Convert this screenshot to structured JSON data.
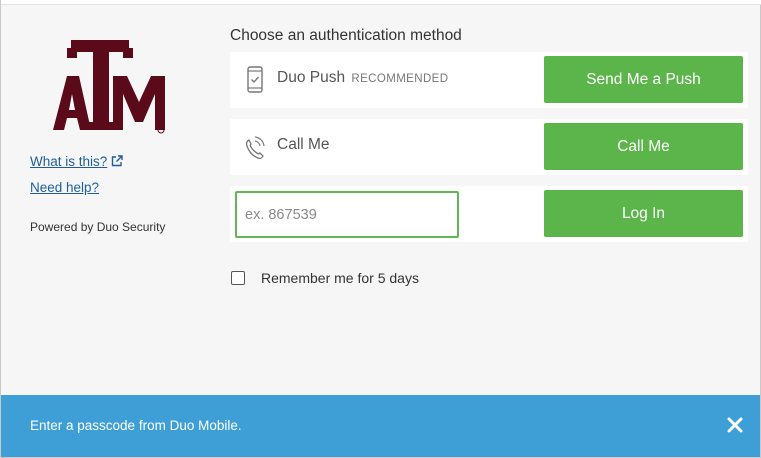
{
  "left_panel": {
    "logo_icon": "texas-am-logo",
    "logo_color": "#5b0a1a",
    "what_is_this": "What is this?",
    "need_help": "Need help?",
    "powered_by": "Powered by Duo Security"
  },
  "auth": {
    "heading": "Choose an authentication method",
    "methods": [
      {
        "icon": "mobile-phone-check-icon",
        "label": "Duo Push",
        "badge": "RECOMMENDED",
        "button": "Send Me a Push"
      },
      {
        "icon": "phone-call-icon",
        "label": "Call Me",
        "button": "Call Me"
      },
      {
        "input_placeholder": "ex. 867539",
        "input_value": "",
        "button": "Log In"
      }
    ],
    "remember_label": "Remember me for 5 days",
    "remember_checked": false
  },
  "message_bar": {
    "text": "Enter a passcode from Duo Mobile.",
    "close_icon": "close-icon",
    "color": "#3d9fd6"
  },
  "colors": {
    "button_green": "#5bb54a",
    "input_focus_border": "#63b654",
    "link": "#1f5e9c"
  }
}
